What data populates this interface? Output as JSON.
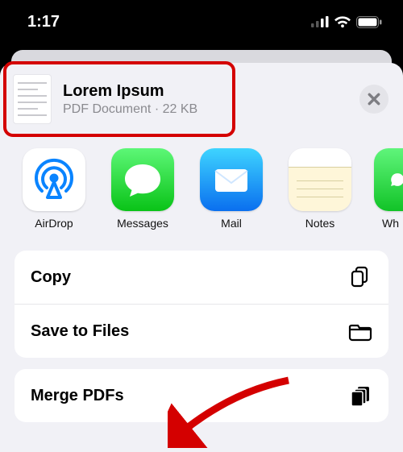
{
  "status": {
    "time": "1:17"
  },
  "header": {
    "title": "Lorem Ipsum",
    "subtitle": "PDF Document · 22 KB"
  },
  "apps": [
    {
      "label": "AirDrop"
    },
    {
      "label": "Messages"
    },
    {
      "label": "Mail"
    },
    {
      "label": "Notes"
    },
    {
      "label": "Wh"
    }
  ],
  "actions": {
    "copy": "Copy",
    "save_to_files": "Save to Files",
    "merge_pdfs": "Merge PDFs"
  }
}
